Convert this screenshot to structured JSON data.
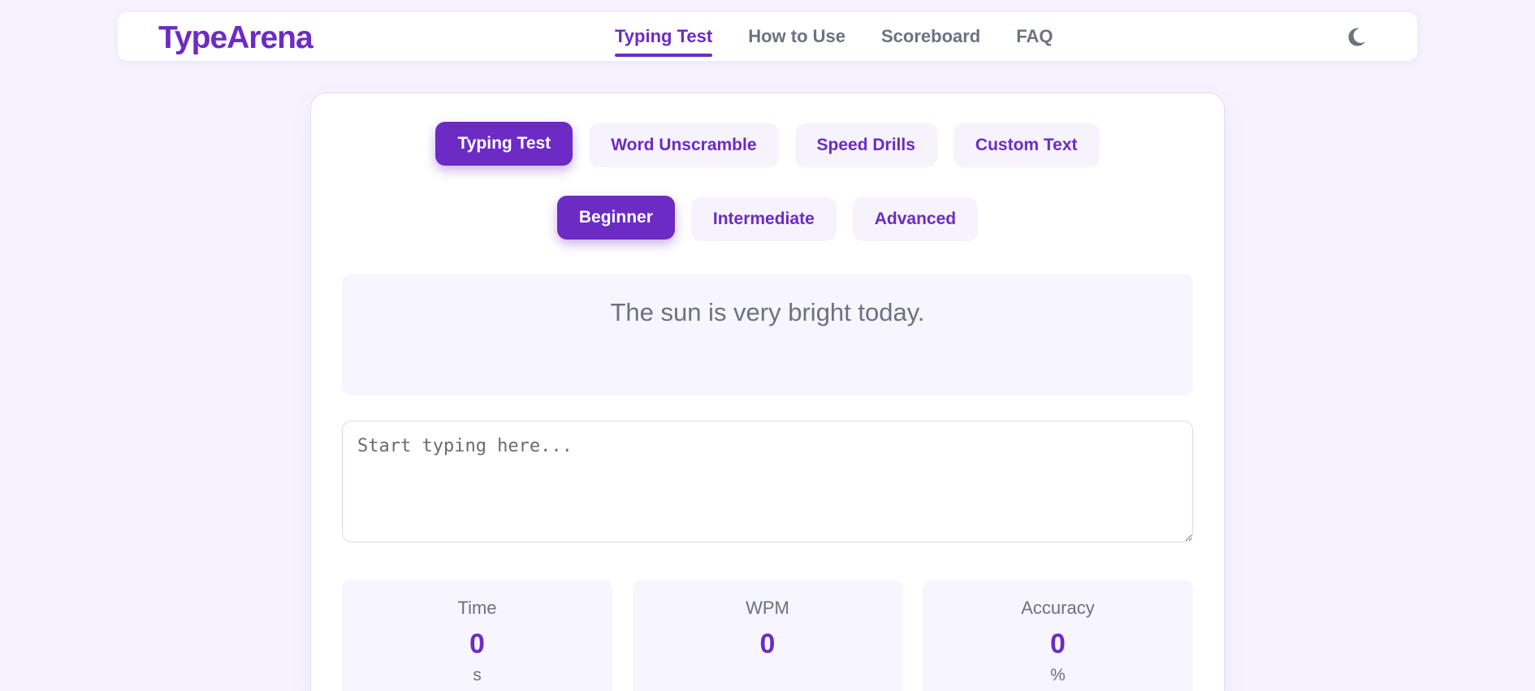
{
  "header": {
    "logo": "TypeArena",
    "nav": [
      {
        "label": "Typing Test",
        "active": true
      },
      {
        "label": "How to Use",
        "active": false
      },
      {
        "label": "Scoreboard",
        "active": false
      },
      {
        "label": "FAQ",
        "active": false
      }
    ],
    "theme_icon": "moon-icon"
  },
  "modes": [
    {
      "label": "Typing Test",
      "active": true
    },
    {
      "label": "Word Unscramble",
      "active": false
    },
    {
      "label": "Speed Drills",
      "active": false
    },
    {
      "label": "Custom Text",
      "active": false
    }
  ],
  "levels": [
    {
      "label": "Beginner",
      "active": true
    },
    {
      "label": "Intermediate",
      "active": false
    },
    {
      "label": "Advanced",
      "active": false
    }
  ],
  "prompt": {
    "text": "The sun is very bright today."
  },
  "input": {
    "placeholder": "Start typing here...",
    "value": ""
  },
  "stats": {
    "time": {
      "label": "Time",
      "value": "0",
      "unit": "s"
    },
    "wpm": {
      "label": "WPM",
      "value": "0",
      "unit": ""
    },
    "accuracy": {
      "label": "Accuracy",
      "value": "0",
      "unit": "%"
    }
  },
  "colors": {
    "accent": "#6c2bc4",
    "background": "#f6f3fd",
    "muted_text": "#6b7280"
  }
}
